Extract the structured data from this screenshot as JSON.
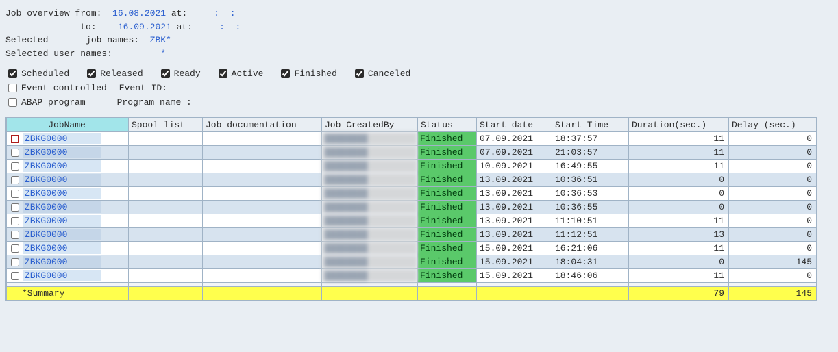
{
  "header": {
    "overview_from_label": "Job overview from:",
    "from_date": "16.08.2021",
    "at_label": "at:",
    "at_time1a": " ",
    "at_time1b": " ",
    "to_label": "to:",
    "to_date": "16.09.2021",
    "at_time2a": " ",
    "at_time2b": " ",
    "selected_label": "Selected",
    "job_names_label": "job names:",
    "job_names_value": "ZBK*",
    "selected_user_label": "Selected user names:",
    "selected_user_value": "*"
  },
  "filters": {
    "scheduled": "Scheduled",
    "released": "Released",
    "ready": "Ready",
    "active": "Active",
    "finished": "Finished",
    "canceled": "Canceled",
    "event_controlled": "Event controlled",
    "event_id": "Event ID:",
    "abap_program": "ABAP program",
    "program_name": "Program name :"
  },
  "columns": {
    "jobname": "JobName",
    "spool": "Spool list",
    "jobdoc": "Job documentation",
    "createdby": "Job CreatedBy",
    "status": "Status",
    "startdate": "Start date",
    "starttime": "Start Time",
    "duration": "Duration(sec.)",
    "delay": "Delay (sec.)"
  },
  "rows": [
    {
      "job": "ZBKG0000",
      "status": "Finished",
      "date": "07.09.2021",
      "time": "18:37:57",
      "dur": "11",
      "delay": "0"
    },
    {
      "job": "ZBKG0000",
      "status": "Finished",
      "date": "07.09.2021",
      "time": "21:03:57",
      "dur": "11",
      "delay": "0"
    },
    {
      "job": "ZBKG0000",
      "status": "Finished",
      "date": "10.09.2021",
      "time": "16:49:55",
      "dur": "11",
      "delay": "0"
    },
    {
      "job": "ZBKG0000",
      "status": "Finished",
      "date": "13.09.2021",
      "time": "10:36:51",
      "dur": "0",
      "delay": "0"
    },
    {
      "job": "ZBKG0000",
      "status": "Finished",
      "date": "13.09.2021",
      "time": "10:36:53",
      "dur": "0",
      "delay": "0"
    },
    {
      "job": "ZBKG0000",
      "status": "Finished",
      "date": "13.09.2021",
      "time": "10:36:55",
      "dur": "0",
      "delay": "0"
    },
    {
      "job": "ZBKG0000",
      "status": "Finished",
      "date": "13.09.2021",
      "time": "11:10:51",
      "dur": "11",
      "delay": "0"
    },
    {
      "job": "ZBKG0000",
      "status": "Finished",
      "date": "13.09.2021",
      "time": "11:12:51",
      "dur": "13",
      "delay": "0"
    },
    {
      "job": "ZBKG0000",
      "status": "Finished",
      "date": "15.09.2021",
      "time": "16:21:06",
      "dur": "11",
      "delay": "0"
    },
    {
      "job": "ZBKG0000",
      "status": "Finished",
      "date": "15.09.2021",
      "time": "18:04:31",
      "dur": "0",
      "delay": "145"
    },
    {
      "job": "ZBKG0000",
      "status": "Finished",
      "date": "15.09.2021",
      "time": "18:46:06",
      "dur": "11",
      "delay": "0"
    }
  ],
  "summary": {
    "label": "*Summary",
    "dur": "79",
    "delay": "145"
  }
}
